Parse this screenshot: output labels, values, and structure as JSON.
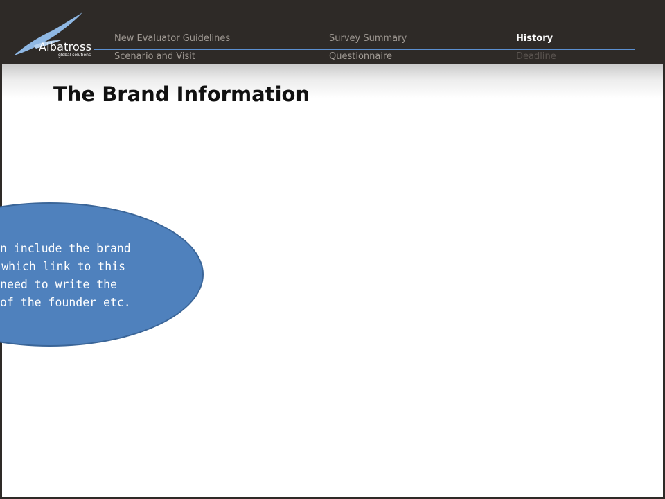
{
  "header": {
    "logo": {
      "name": "Albatross",
      "tagline": "global solutions"
    },
    "nav": {
      "row1": [
        {
          "label": "New Evaluator Guidelines",
          "state": "normal"
        },
        {
          "label": "Survey Summary",
          "state": "normal"
        },
        {
          "label": "History",
          "state": "active"
        }
      ],
      "row2": [
        {
          "label": "Scenario and Visit",
          "state": "normal"
        },
        {
          "label": "Questionnaire",
          "state": "normal"
        },
        {
          "label": "Deadline",
          "state": "dim"
        }
      ]
    }
  },
  "main": {
    "title": "The Brand Information",
    "callout": {
      "lines": [
        "n include the brand",
        " which link to this",
        "need to write the",
        "of the founder etc."
      ]
    }
  },
  "colors": {
    "header_bg": "#2e2a27",
    "accent_line": "#5b8fd0",
    "callout_fill": "#4f81bd"
  }
}
